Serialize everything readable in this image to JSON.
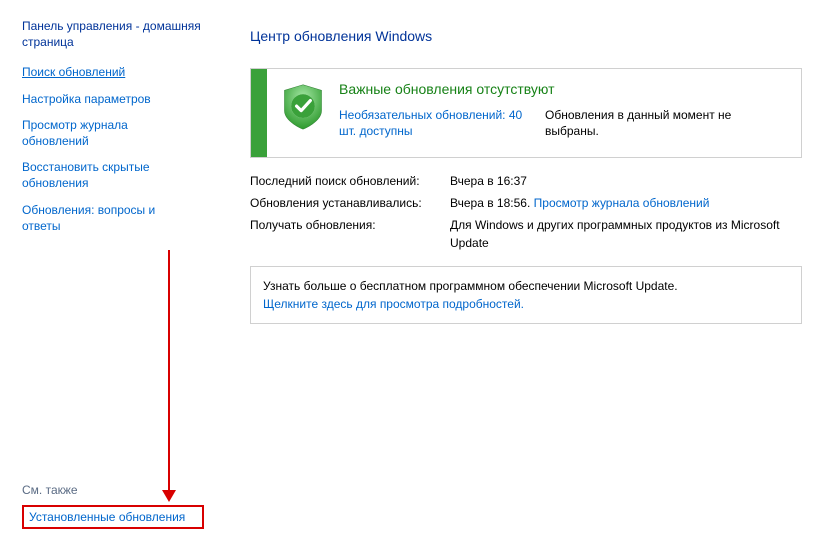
{
  "sidebar": {
    "title": "Панель управления - домашняя страница",
    "links": {
      "search": "Поиск обновлений",
      "settings": "Настройка параметров",
      "history": "Просмотр журнала обновлений",
      "restore": "Восстановить скрытые обновления",
      "faq": "Обновления: вопросы и ответы"
    },
    "see_also": "См. также",
    "installed": "Установленные обновления"
  },
  "main": {
    "title": "Центр обновления Windows",
    "status": {
      "heading": "Важные обновления отсутствуют",
      "optional_link": "Необязательных обновлений: 40 шт. доступны",
      "selected": "Обновления в данный момент не выбраны."
    },
    "info": {
      "last_search_label": "Последний поиск обновлений:",
      "last_search_value": "Вчера в 16:37",
      "last_install_label": "Обновления устанавливались:",
      "last_install_value": "Вчера в 18:56.",
      "last_install_link": "Просмотр журнала обновлений",
      "receive_label": "Получать обновления:",
      "receive_value": "Для Windows и других программных продуктов из Microsoft Update"
    },
    "learn": {
      "text": "Узнать больше о бесплатном программном обеспечении Microsoft Update.",
      "link": "Щелкните здесь для просмотра подробностей."
    }
  }
}
